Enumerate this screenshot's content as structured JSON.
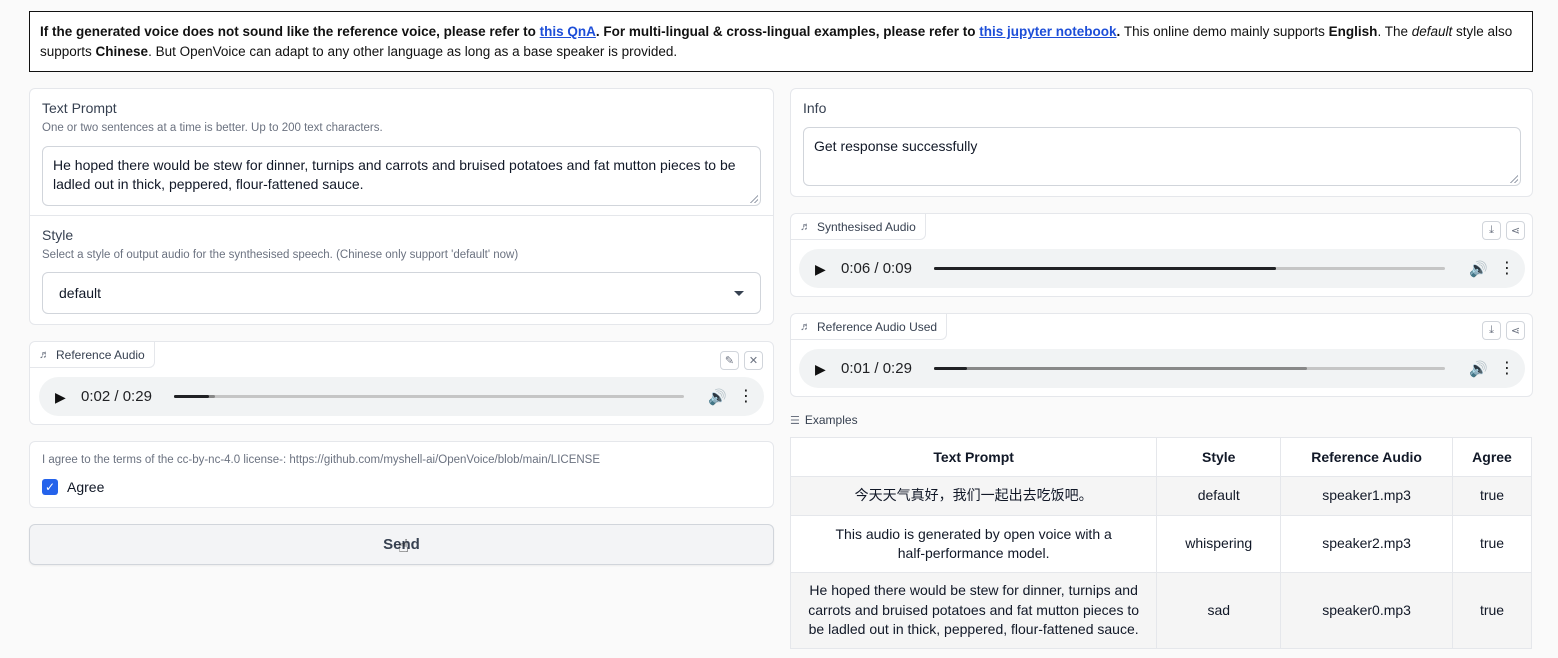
{
  "notice": {
    "part1": "If the generated voice does not sound like the reference voice, please refer to ",
    "link1": "this QnA",
    "part2": ". For multi-lingual & cross-lingual examples, please refer to ",
    "link2": "this jupyter notebook",
    "part3": ".",
    "part4": " This online demo mainly supports ",
    "english": "English",
    "part5": ". The ",
    "default_word": "default",
    "part6": " style also supports ",
    "chinese": "Chinese",
    "part7": ". But OpenVoice can adapt to any other language as long as a base speaker is provided."
  },
  "text_prompt": {
    "label": "Text Prompt",
    "sublabel": "One or two sentences at a time is better. Up to 200 text characters.",
    "value": "He hoped there would be stew for dinner, turnips and carrots and bruised potatoes and fat mutton pieces to be ladled out in thick, peppered, flour-fattened sauce."
  },
  "style": {
    "label": "Style",
    "sublabel": "Select a style of output audio for the synthesised speech. (Chinese only support 'default' now)",
    "selected": "default"
  },
  "reference_audio": {
    "label": "Reference Audio",
    "current": "0:02",
    "duration": "0:29",
    "progress": 0.069,
    "buffered": 0.08
  },
  "agree": {
    "label": "I agree to the terms of the cc-by-nc-4.0 license-: https://github.com/myshell-ai/OpenVoice/blob/main/LICENSE",
    "checkbox_label": "Agree",
    "checked": true
  },
  "send_button": "Send",
  "info": {
    "label": "Info",
    "value": "Get response successfully"
  },
  "synthesised_audio": {
    "label": "Synthesised Audio",
    "current": "0:06",
    "duration": "0:09",
    "progress": 0.67,
    "buffered": 0.67
  },
  "reference_audio_used": {
    "label": "Reference Audio Used",
    "current": "0:01",
    "duration": "0:29",
    "progress": 0.065,
    "buffered": 0.73
  },
  "examples": {
    "label": "Examples",
    "headers": [
      "Text Prompt",
      "Style",
      "Reference Audio",
      "Agree"
    ],
    "rows": [
      [
        "今天天气真好，我们一起出去吃饭吧。",
        "default",
        "speaker1.mp3",
        "true"
      ],
      [
        "This audio is generated by open voice with a half-performance model.",
        "whispering",
        "speaker2.mp3",
        "true"
      ],
      [
        "He hoped there would be stew for dinner, turnips and carrots and bruised potatoes and fat mutton pieces to be ladled out in thick, peppered, flour-fattened sauce.",
        "sad",
        "speaker0.mp3",
        "true"
      ]
    ]
  },
  "icons": {
    "audio_tag": "music-note-icon",
    "play": "play-icon",
    "volume": "volume-icon",
    "more": "more-vertical-icon",
    "edit": "pencil-icon",
    "close": "close-icon",
    "download": "download-icon",
    "share": "share-icon",
    "examples": "list-icon"
  },
  "colors": {
    "link": "#1d4ed8",
    "checkbox": "#2563eb"
  }
}
